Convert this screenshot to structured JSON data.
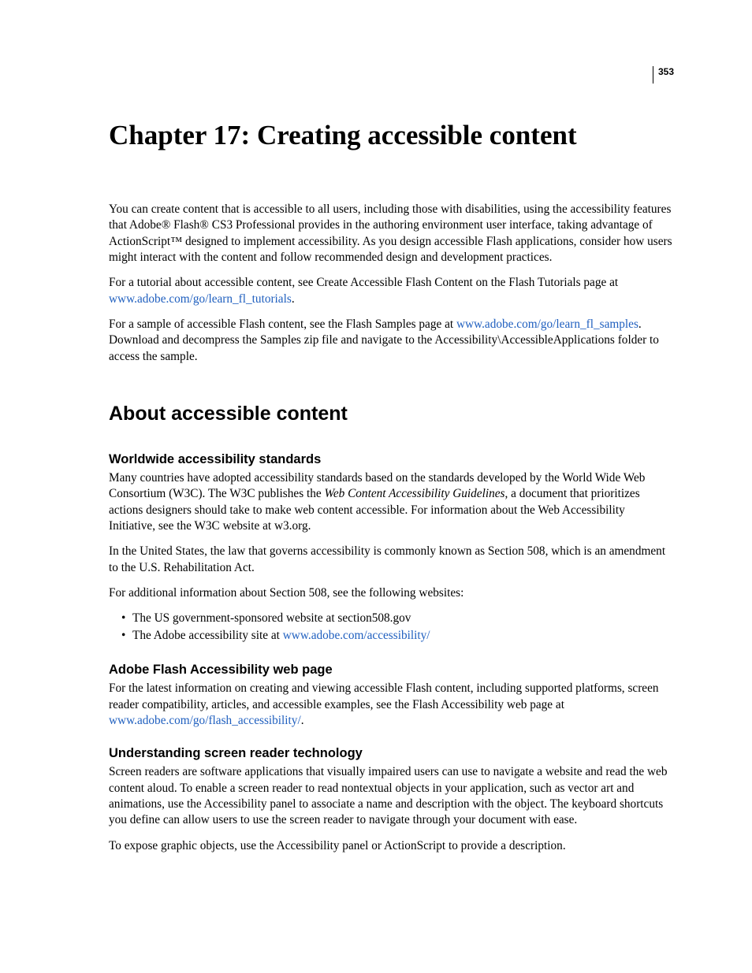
{
  "page_number": "353",
  "title": "Chapter 17: Creating accessible content",
  "intro": {
    "p1": "You can create content that is accessible to all users, including those with disabilities, using the accessibility features that Adobe® Flash® CS3 Professional provides in the authoring environment user interface, taking advantage of ActionScript™ designed to implement accessibility. As you design accessible Flash applications, consider how users might interact with the content and follow recommended design and development practices.",
    "p2_a": "For a tutorial about accessible content, see Create Accessible Flash Content on the Flash Tutorials page at ",
    "p2_link": "www.adobe.com/go/learn_fl_tutorials",
    "p2_b": ".",
    "p3_a": "For a sample of accessible Flash content, see the Flash Samples page at ",
    "p3_link": "www.adobe.com/go/learn_fl_samples",
    "p3_b": ". Download and decompress the Samples zip file and navigate to the Accessibility\\AccessibleApplications folder to access the sample."
  },
  "section_heading": "About accessible content",
  "sub1": {
    "heading": "Worldwide accessibility standards",
    "p1_a": "Many countries have adopted accessibility standards based on the standards developed by the World Wide Web Consortium (W3C). The W3C publishes the ",
    "p1_em": "Web Content Accessibility Guidelines",
    "p1_b": ", a document that prioritizes actions designers should take to make web content accessible. For information about the Web Accessibility Initiative, see the W3C website at w3.org.",
    "p2": "In the United States, the law that governs accessibility is commonly known as Section 508, which is an amendment to the U.S. Rehabilitation Act.",
    "p3": "For additional information about Section 508, see the following websites:",
    "bullet1": "The US government-sponsored website at section508.gov",
    "bullet2_a": "The Adobe accessibility site at ",
    "bullet2_link": "www.adobe.com/accessibility/"
  },
  "sub2": {
    "heading": "Adobe Flash Accessibility web page",
    "p1_a": "For the latest information on creating and viewing accessible Flash content, including supported platforms, screen reader compatibility, articles, and accessible examples, see the Flash Accessibility web page at ",
    "p1_link": "www.adobe.com/go/flash_accessibility/",
    "p1_b": "."
  },
  "sub3": {
    "heading": "Understanding screen reader technology",
    "p1": "Screen readers are software applications that visually impaired users can use to navigate a website and read the web content aloud. To enable a screen reader to read nontextual objects in your application, such as vector art and animations, use the Accessibility panel to associate a name and description with the object. The keyboard shortcuts you define can allow users to use the screen reader to navigate through your document with ease.",
    "p2": "To expose graphic objects, use the Accessibility panel or ActionScript to provide a description."
  }
}
